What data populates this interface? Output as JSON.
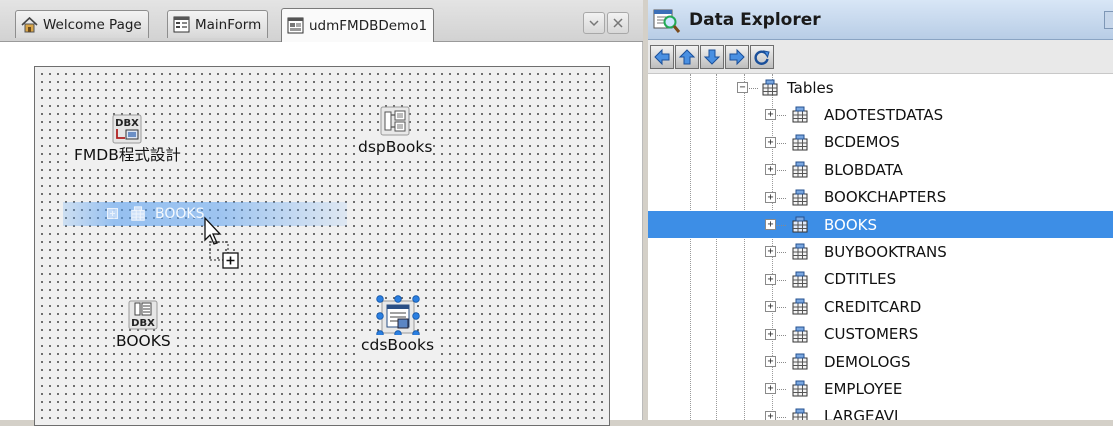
{
  "designer": {
    "tabs": [
      {
        "label": "Welcome Page",
        "icon": "home-icon"
      },
      {
        "label": "MainForm",
        "icon": "form-icon"
      },
      {
        "label": "udmFMDBDemo1",
        "icon": "datamodule-icon"
      }
    ],
    "active_tab": 2,
    "components": {
      "dbx_connection_label": "FMDB程式設計",
      "dsp_label": "dspBooks",
      "books_label": "BOOKS",
      "cds_label": "cdsBooks",
      "drag_label": "BOOKS"
    }
  },
  "explorer": {
    "title": "Data Explorer",
    "nav_buttons": [
      "back-icon",
      "up-icon",
      "down-icon",
      "forward-icon",
      "refresh-icon"
    ],
    "tables_node": "Tables",
    "selected_index": 4,
    "tables": [
      "ADOTESTDATAS",
      "BCDEMOS",
      "BLOBDATA",
      "BOOKCHAPTERS",
      "BOOKS",
      "BUYBOOKTRANS",
      "CDTITLES",
      "CREDITCARD",
      "CUSTOMERS",
      "DEMOLOGS",
      "EMPLOYEE",
      "LARGEAVI"
    ],
    "colors": {
      "selection": "#3d8ee6",
      "header": "#c9d9ee"
    }
  }
}
